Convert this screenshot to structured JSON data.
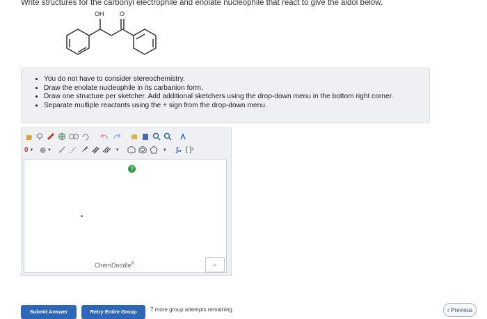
{
  "question": {
    "text": "Write structures for the carbonyl electrophile and enolate nucleophile that react to give the aldol below."
  },
  "molecule": {
    "oh_label": "OH",
    "o_label": "O"
  },
  "instructions": [
    "You do not have to consider stereochemistry.",
    "Draw the enolate nucleophile in its carbanion form.",
    "Draw one structure per sketcher. Add additional sketchers using the drop-down menu in the bottom right corner.",
    "Separate multiple reactants using the + sign from the drop-down menu."
  ],
  "sketcher": {
    "charge_value": "0",
    "plus_symbol": "⊕",
    "help_symbol": "?",
    "brand": "ChemDoodle",
    "brand_mark": "®",
    "formula_tool": "∫ₙ",
    "bracket_tool": "[ ]",
    "bracket_mark": "±",
    "dropdown_chevron": "›"
  },
  "footer": {
    "submit_label": "Submit Answer",
    "retry_label": "Retry Entire Group",
    "attempts_text": "7 more group attempts remaining",
    "previous_label": "Previous"
  },
  "colors": {
    "primary": "#2f67b8",
    "panel_bg": "#eef0f3",
    "help_green": "#2e9b45"
  }
}
